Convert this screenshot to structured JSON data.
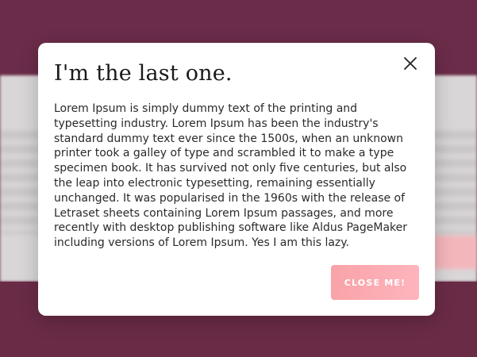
{
  "modal": {
    "title": "I'm the last one.",
    "body": "Lorem Ipsum is simply dummy text of the printing and typesetting industry. Lorem Ipsum has been the industry's standard dummy text ever since the 1500s, when an unknown printer took a galley of type and scrambled it to make a type specimen book. It has survived not only five centuries, but also the leap into electronic typesetting, remaining essentially unchanged. It was popularised in the 1960s with the release of Letraset sheets containing Lorem Ipsum passages, and more recently with desktop publishing software like Aldus PageMaker including versions of Lorem Ipsum. Yes I am this lazy.",
    "close_button_label": "CLOSE ME!",
    "close_icon": "close-icon"
  },
  "colors": {
    "overlay": "#6f2f4a",
    "modal_background": "#ffffff",
    "button_gradient_start": "#f8a3a8",
    "button_gradient_end": "#ffb4bd",
    "button_text": "#ffffff"
  }
}
